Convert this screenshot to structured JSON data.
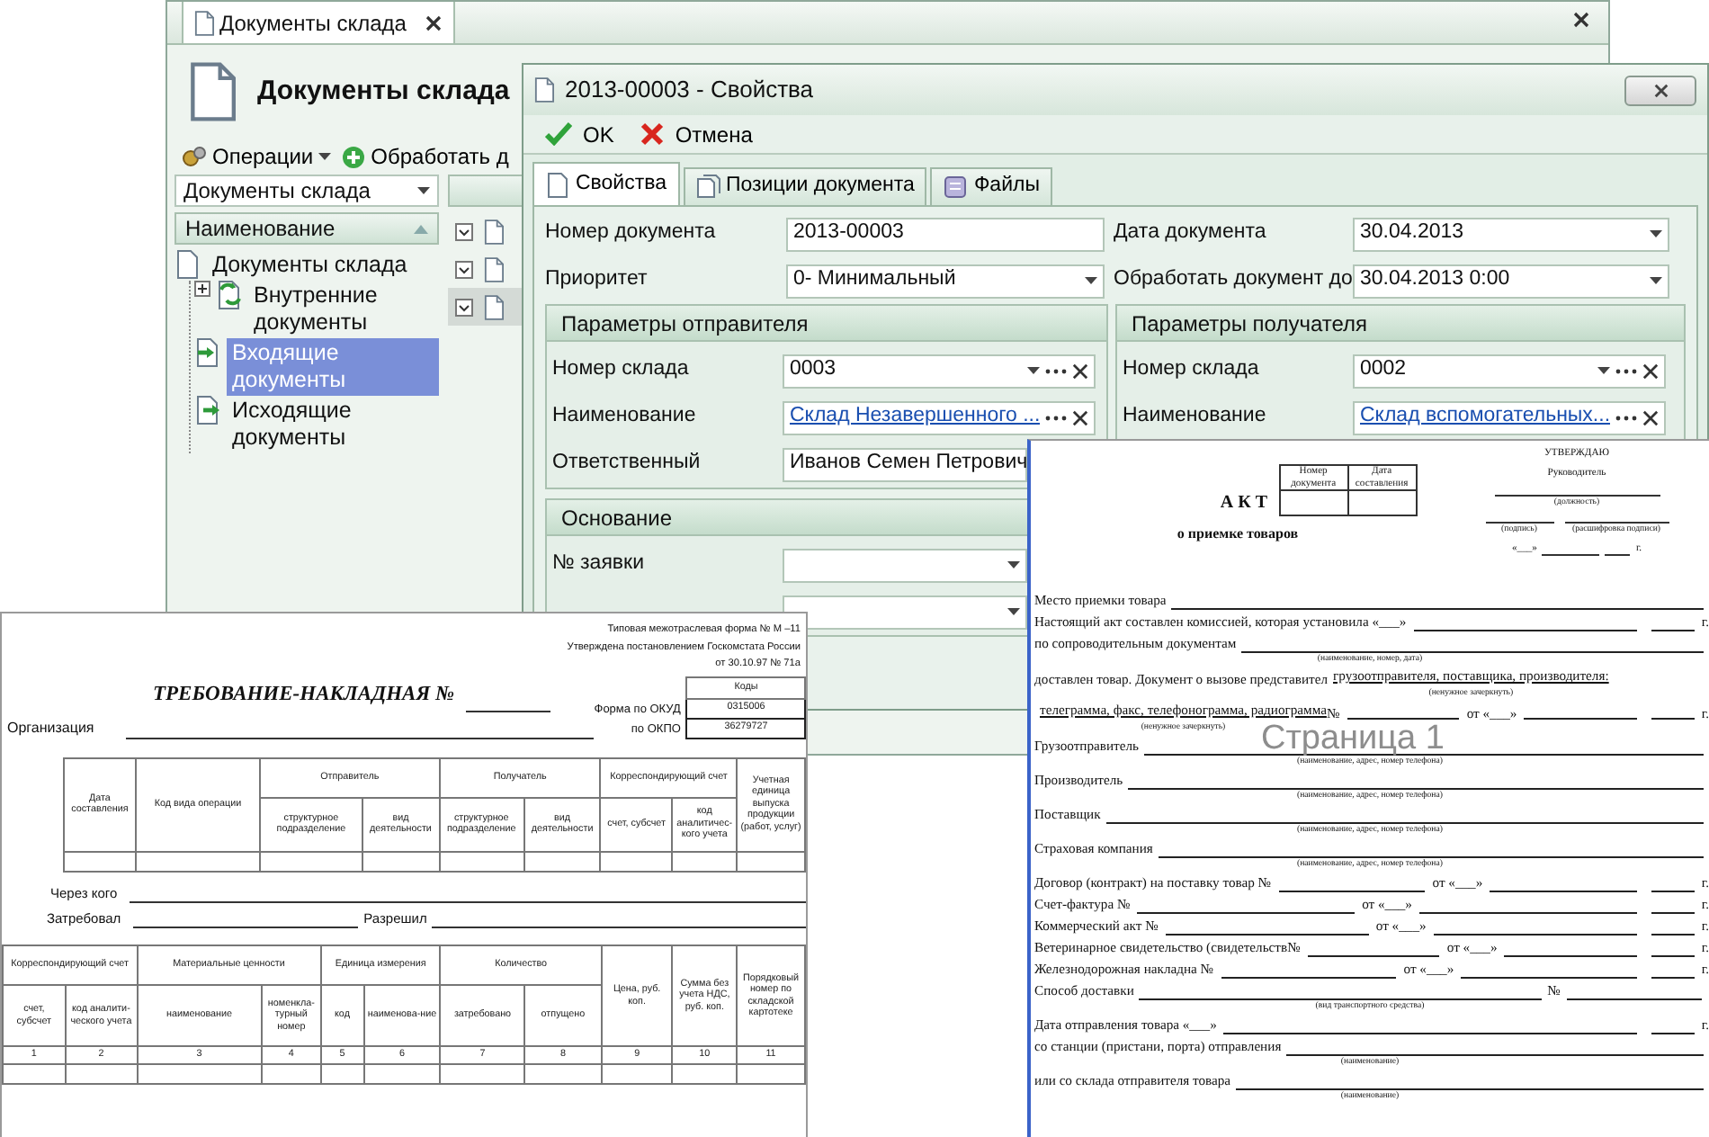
{
  "main_window": {
    "tab_title": "Документы склада",
    "title": "Документы склада",
    "toolbar": [
      {
        "label": "Операции",
        "kind": "menu"
      },
      {
        "label": "Обработать д",
        "kind": "add"
      }
    ],
    "filter": "Документы склада",
    "tree_header": "Наименование",
    "tree": [
      {
        "label": "Документы склада",
        "kind": "document",
        "selected": false,
        "children": [
          {
            "label": "Внутренние документы",
            "kind": "internal",
            "selected": false,
            "has_children": true
          },
          {
            "label": "Входящие документы",
            "kind": "incoming",
            "selected": true,
            "has_children": false
          },
          {
            "label": "Исходящие документы",
            "kind": "outgoing",
            "selected": false,
            "has_children": false
          }
        ]
      }
    ],
    "grid_rows": [
      {
        "selected": false
      },
      {
        "selected": false
      },
      {
        "selected": true
      }
    ]
  },
  "dialog": {
    "title": "2013-00003 - Свойства",
    "toolbar": [
      {
        "label": "OK",
        "kind": "ok"
      },
      {
        "label": "Отмена",
        "kind": "cancel"
      }
    ],
    "tabs": [
      {
        "label": "Свойства",
        "kind": "properties",
        "selected": true
      },
      {
        "label": "Позиции документа",
        "kind": "items",
        "selected": false
      },
      {
        "label": "Файлы",
        "kind": "files",
        "selected": false
      }
    ],
    "fields": [
      {
        "label": "Номер документа",
        "value": "2013-00003",
        "kind": "text"
      },
      {
        "label": "Дата документа",
        "value": "30.04.2013",
        "kind": "dropdown"
      },
      {
        "label": "Приоритет",
        "value": "0- Минимальный",
        "kind": "dropdown"
      },
      {
        "label": "Обработать документ до",
        "value": "30.04.2013 0:00",
        "kind": "dropdown"
      }
    ],
    "sections": [
      {
        "title": "Параметры отправителя",
        "fields": [
          {
            "label": "Номер склада",
            "value": "0003",
            "kind": "lookup"
          },
          {
            "label": "Наименование",
            "value": "Склад Незавершенного ...",
            "kind": "link"
          },
          {
            "label": "Ответственный",
            "value": "Иванов Семен Петрович",
            "kind": "dropdown"
          }
        ]
      },
      {
        "title": "Параметры получателя",
        "fields": [
          {
            "label": "Номер склада",
            "value": "0002",
            "kind": "lookup"
          },
          {
            "label": "Наименование",
            "value": "Склад вспомогательных...",
            "kind": "link"
          }
        ]
      },
      {
        "title": "Основание",
        "fields": [
          {
            "label": "№ заявки",
            "kind": "dropdown"
          },
          {
            "kind": "dropdown"
          }
        ]
      }
    ]
  },
  "requisition": {
    "header_lines": [
      "Типовая межотраслевая форма № М –11",
      "Утверждена постановлением Госкомстата России",
      "от 30.10.97 № 71а"
    ],
    "title": "ТРЕБОВАНИЕ-НАКЛАДНАЯ №",
    "codes_title": "Коды",
    "codes": [
      {
        "label": "Форма по ОКУД",
        "value": "0315006"
      },
      {
        "label": "по ОКПО",
        "value": "36279727"
      }
    ],
    "organization_label": "Организация",
    "table_1": [
      {
        "label": "Дата составления"
      },
      {
        "label": "Код вида операции"
      },
      {
        "label": "Отправитель",
        "children": [
          "структурное подразделение",
          "вид деятельности"
        ]
      },
      {
        "label": "Получатель",
        "children": [
          "структурное подразделение",
          "вид деятельности"
        ]
      },
      {
        "label": "Корреспондирующий счет",
        "children": [
          "счет, субсчет",
          "код аналитичес-кого учета"
        ]
      },
      {
        "label": "Учетная единица выпуска продукции (работ, услуг)"
      }
    ],
    "signatures": [
      {
        "label": "Через кого"
      },
      {
        "label": "Затребовал"
      },
      {
        "label": "Разрешил"
      }
    ],
    "table_2": [
      {
        "label": "Корреспондирующий счет",
        "children": [
          "счет, субсчет",
          "код аналити-ческого учета"
        ]
      },
      {
        "label": "Материальные ценности",
        "children": [
          "наименование",
          "номенкла-турный номер"
        ]
      },
      {
        "label": "Единица измерения",
        "children": [
          "код",
          "наименова-ние"
        ]
      },
      {
        "label": "Количество",
        "children": [
          "затребовано",
          "отпущено"
        ]
      },
      {
        "label": "Цена, руб. коп."
      },
      {
        "label": "Сумма без учета НДС, руб. коп."
      },
      {
        "label": "Порядковый номер по складской картотеке"
      }
    ],
    "column_numbers": [
      "1",
      "2",
      "3",
      "4",
      "5",
      "6",
      "7",
      "8",
      "9",
      "10",
      "11"
    ]
  },
  "act": {
    "doc_table": [
      "Номер документа",
      "Дата составления"
    ],
    "title": "А К Т",
    "subtitle": "о приемке товаров",
    "approval": {
      "title": "УТВЕРЖДАЮ",
      "role": "Руководитель",
      "position_caption": "(должность)",
      "signature_caption": "(подпись)",
      "name_caption": "(расшифровка подписи)",
      "date": "«___»",
      "year": "г."
    },
    "rows": [
      {
        "parts": [
          "Место приемки товара",
          {
            "kind": "fill"
          }
        ]
      },
      {
        "parts": [
          "Настоящий акт составлен комиссией, которая установила «___»",
          {
            "kind": "blank"
          },
          {
            "kind": "short"
          },
          "г."
        ]
      },
      {
        "parts": [
          "по сопроводительным документам",
          {
            "kind": "fill"
          }
        ],
        "caption": "(наименование, номер, дата)"
      },
      {
        "parts": [
          "доставлен товар.  Документ о вызове представител",
          {
            "kind": "underlined",
            "text": "грузоотправителя, поставщика, производителя:",
            "caption": "(ненужное зачеркнуть)"
          }
        ]
      },
      {
        "parts": [
          {
            "kind": "underlined",
            "text": "телеграмма, факс, телефонограмма, радиограмма",
            "caption": "(ненужное зачеркнуть)"
          },
          "№",
          {
            "kind": "blank"
          },
          "от «___»",
          {
            "kind": "blank"
          },
          {
            "kind": "short"
          },
          "г."
        ]
      },
      {
        "parts": [
          "Грузоотправитель",
          {
            "kind": "fill"
          }
        ],
        "caption": "(наименование, адрес, номер телефона)"
      },
      {
        "parts": [
          "Производитель",
          {
            "kind": "fill"
          }
        ],
        "caption": "(наименование, адрес, номер телефона)"
      },
      {
        "parts": [
          "Поставщик",
          {
            "kind": "fill"
          }
        ],
        "caption": "(наименование, адрес, номер телефона)"
      },
      {
        "parts": [
          "Страховая компания",
          {
            "kind": "fill"
          }
        ],
        "caption": "(наименование, адрес, номер телефона)"
      },
      {
        "parts": [
          "Договор (контракт) на поставку товар  №",
          {
            "kind": "blank"
          },
          "от «___»",
          {
            "kind": "blank"
          },
          {
            "kind": "short"
          },
          "г."
        ]
      },
      {
        "parts": [
          "Счет-фактура  №",
          {
            "kind": "blank"
          },
          "от «___»",
          {
            "kind": "blank"
          },
          {
            "kind": "short"
          },
          "г."
        ]
      },
      {
        "parts": [
          "Коммерческий акт  №",
          {
            "kind": "blank"
          },
          "от «___»",
          {
            "kind": "blank"
          },
          {
            "kind": "short"
          },
          "г."
        ]
      },
      {
        "parts": [
          "Ветеринарное свидетельство (свидетельств",
          "№",
          {
            "kind": "blank"
          },
          "от «___»",
          {
            "kind": "blank"
          },
          {
            "kind": "short"
          },
          "г."
        ]
      },
      {
        "parts": [
          "Железнодорожная накладна  №",
          {
            "kind": "blank"
          },
          "от «___»",
          {
            "kind": "blank"
          },
          {
            "kind": "short"
          },
          "г."
        ]
      },
      {
        "parts": [
          "Способ доставки",
          {
            "kind": "fill"
          },
          "№",
          {
            "kind": "blank"
          }
        ],
        "caption": "(вид транспортного средства)"
      },
      {
        "parts": [
          "Дата отправления товара «___»",
          {
            "kind": "blank"
          },
          {
            "kind": "short"
          },
          "г."
        ]
      },
      {
        "parts": [
          "со станции (пристани, порта) отправления",
          {
            "kind": "fill"
          }
        ],
        "caption": "(наименование)"
      },
      {
        "parts": [
          "или со склада отправителя товара",
          {
            "kind": "fill"
          }
        ],
        "caption": "(наименование)"
      }
    ],
    "page_label": "Страница 1"
  }
}
